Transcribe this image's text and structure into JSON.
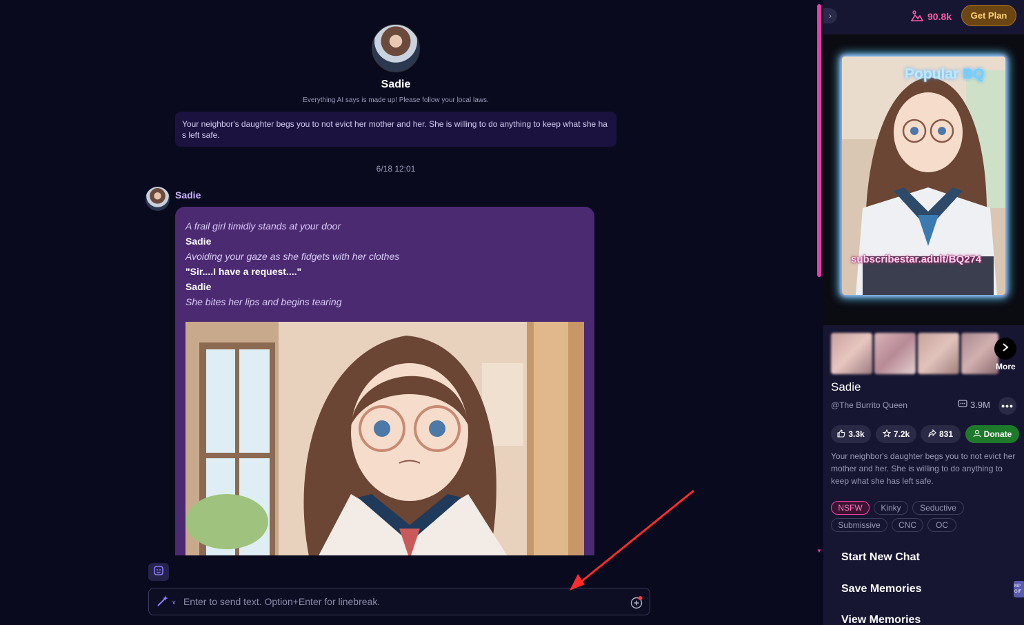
{
  "character": {
    "name": "Sadie",
    "disclaimer": "Everything AI says is made up! Please follow your local laws.",
    "scenario": "Your neighbor's daughter begs you to not evict her mother and her. She is willing to do anything to keep what she has left safe."
  },
  "chat": {
    "timestamp": "6/18 12:01",
    "message": {
      "sender": "Sadie",
      "lines": [
        {
          "style": "italic",
          "text": "A frail girl timidly stands at your door"
        },
        {
          "style": "bold",
          "text": "Sadie"
        },
        {
          "style": "italic",
          "text": "Avoiding your gaze as she fidgets with her clothes"
        },
        {
          "style": "bold",
          "text": "\"Sir....I have a request....\""
        },
        {
          "style": "bold",
          "text": "Sadie"
        },
        {
          "style": "italic",
          "text": "She bites her lips and begins tearing"
        }
      ]
    },
    "input": {
      "placeholder": "Enter to send text. Option+Enter for linebreak."
    }
  },
  "panel": {
    "gems": "90.8k",
    "get_plan": "Get Plan",
    "cover": {
      "badge_word": "Popular",
      "badge_tag": "BQ",
      "watermark": "subscribestar.adult/BQ274"
    },
    "more_label": "More",
    "name": "Sadie",
    "creator": "@The Burrito Queen",
    "chat_count": "3.9M",
    "stats": {
      "likes": "3.3k",
      "favorites": "7.2k",
      "shares": "831",
      "donate": "Donate"
    },
    "description": "Your neighbor's daughter begs you to not evict her mother and her. She is willing to do anything to keep what she has left safe.",
    "tags": [
      "NSFW",
      "Kinky",
      "Seductive",
      "Submissive",
      "CNC",
      "OC"
    ],
    "actions": {
      "start_new_chat": "Start New Chat",
      "save_memories": "Save Memories",
      "view_memories": "View Memories"
    },
    "side_badge": "MP GIF"
  },
  "colors": {
    "accent_pink": "#ff3fa6",
    "bubble": "#4b2a72",
    "get_plan_bg": "#6b4512",
    "donate_green": "#1d7a2a"
  },
  "icons": [
    "gem-icon",
    "persona-icon",
    "magic-wand-icon",
    "add-circle-icon",
    "chevron-right-icon",
    "chat-bubble-icon",
    "more-dots-icon",
    "thumbs-up-icon",
    "star-icon",
    "share-icon",
    "donate-icon",
    "collapse-icon"
  ]
}
